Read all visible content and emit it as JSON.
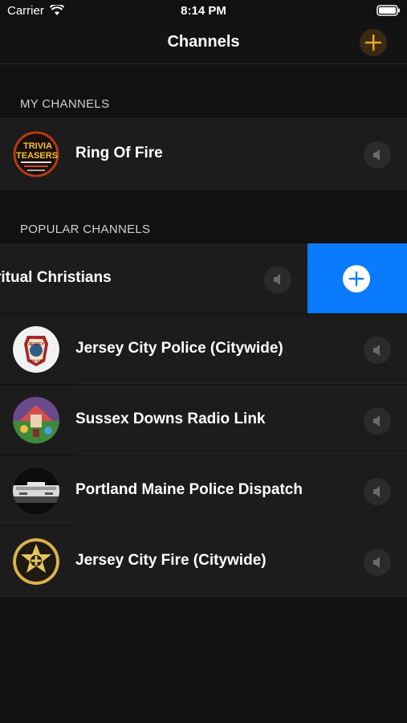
{
  "status_bar": {
    "carrier": "Carrier",
    "time": "8:14 PM"
  },
  "nav": {
    "title": "Channels",
    "add_icon": "plus-icon",
    "accent_color": "#f5a623"
  },
  "sections": {
    "my_channels": "MY CHANNELS",
    "popular_channels": "POPULAR CHANNELS"
  },
  "my_channels": [
    {
      "name": "Ring Of Fire",
      "avatar_text": "TRIVIA TEASERS"
    }
  ],
  "popular_channels": [
    {
      "name": "ritual Christians"
    },
    {
      "name": "Jersey City Police (Citywide)"
    },
    {
      "name": "Sussex Downs Radio Link"
    },
    {
      "name": "Portland Maine Police Dispatch"
    },
    {
      "name": "Jersey City Fire (Citywide)"
    }
  ],
  "swipe_action": {
    "color": "#0a7bff",
    "icon": "add-circle-icon"
  }
}
